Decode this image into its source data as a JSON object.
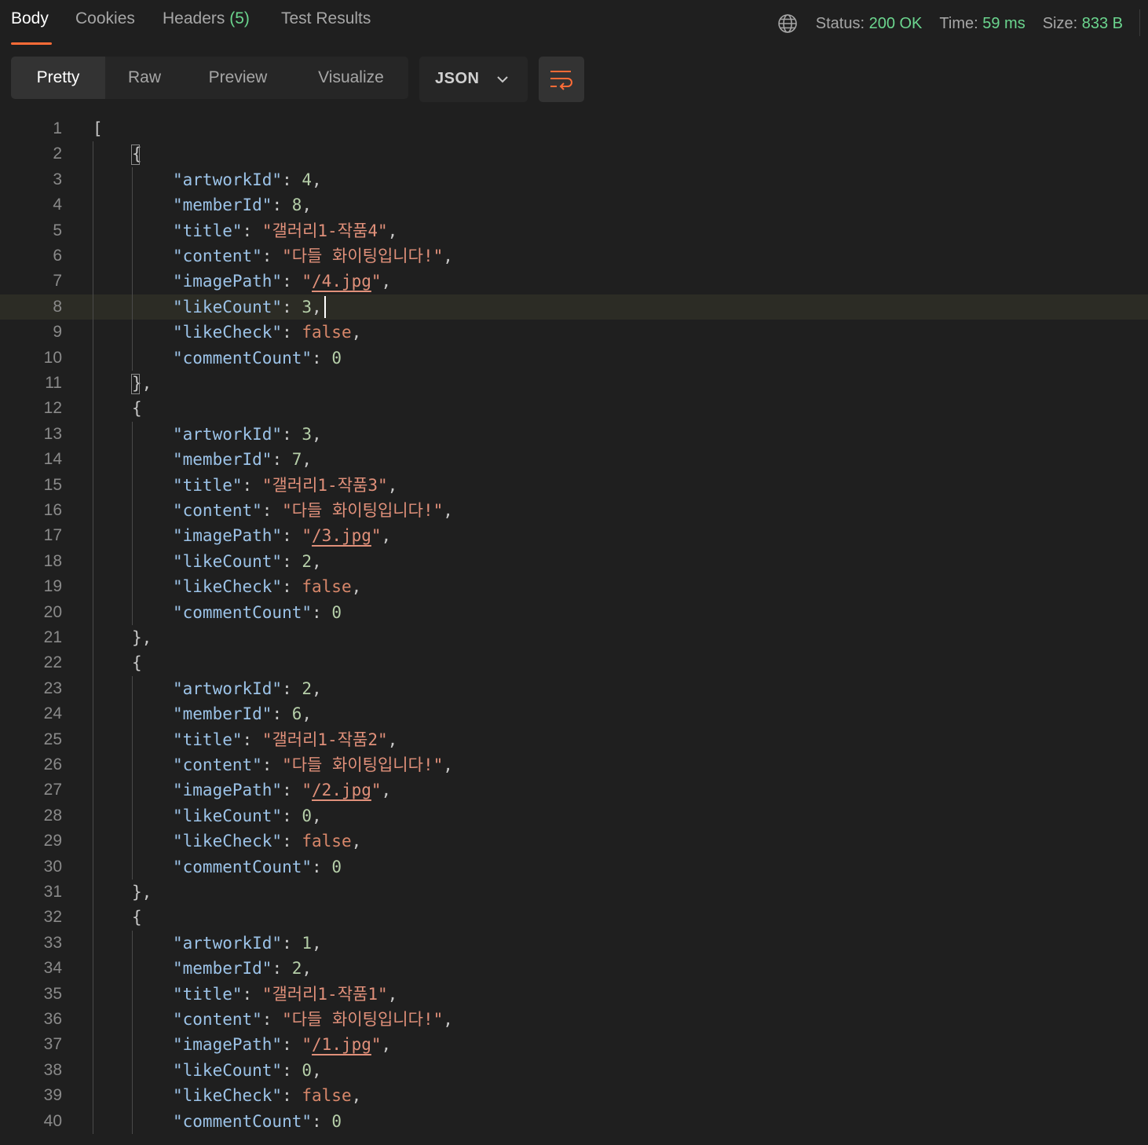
{
  "tabs": [
    {
      "label": "Body"
    },
    {
      "label": "Cookies"
    },
    {
      "label": "Headers",
      "count": "(5)"
    },
    {
      "label": "Test Results"
    }
  ],
  "status": {
    "status_label": "Status:",
    "status_value": "200 OK",
    "time_label": "Time:",
    "time_value": "59 ms",
    "size_label": "Size:",
    "size_value": "833 B"
  },
  "views": [
    "Pretty",
    "Raw",
    "Preview",
    "Visualize"
  ],
  "format": "JSON",
  "colors": {
    "accent": "#ff6c37",
    "success": "#6bd58e",
    "key": "#9cc3e8",
    "number": "#b5cea8",
    "string": "#e0907a"
  },
  "items": [
    {
      "artworkId": "4",
      "memberId": "8",
      "title": "갤러리1-작품4",
      "content": "다들 화이팅입니다!",
      "imagePath": "/4.jpg",
      "likeCount": "3",
      "likeCheck": "false",
      "commentCount": "0"
    },
    {
      "artworkId": "3",
      "memberId": "7",
      "title": "갤러리1-작품3",
      "content": "다들 화이팅입니다!",
      "imagePath": "/3.jpg",
      "likeCount": "2",
      "likeCheck": "false",
      "commentCount": "0"
    },
    {
      "artworkId": "2",
      "memberId": "6",
      "title": "갤러리1-작품2",
      "content": "다들 화이팅입니다!",
      "imagePath": "/2.jpg",
      "likeCount": "0",
      "likeCheck": "false",
      "commentCount": "0"
    },
    {
      "artworkId": "1",
      "memberId": "2",
      "title": "갤러리1-작품1",
      "content": "다들 화이팅입니다!",
      "imagePath": "/1.jpg",
      "likeCount": "0",
      "likeCheck": "false",
      "commentCount": "0"
    }
  ],
  "editor": {
    "first_line_number": 1,
    "last_line_number": 40,
    "cursor_line": 8
  }
}
